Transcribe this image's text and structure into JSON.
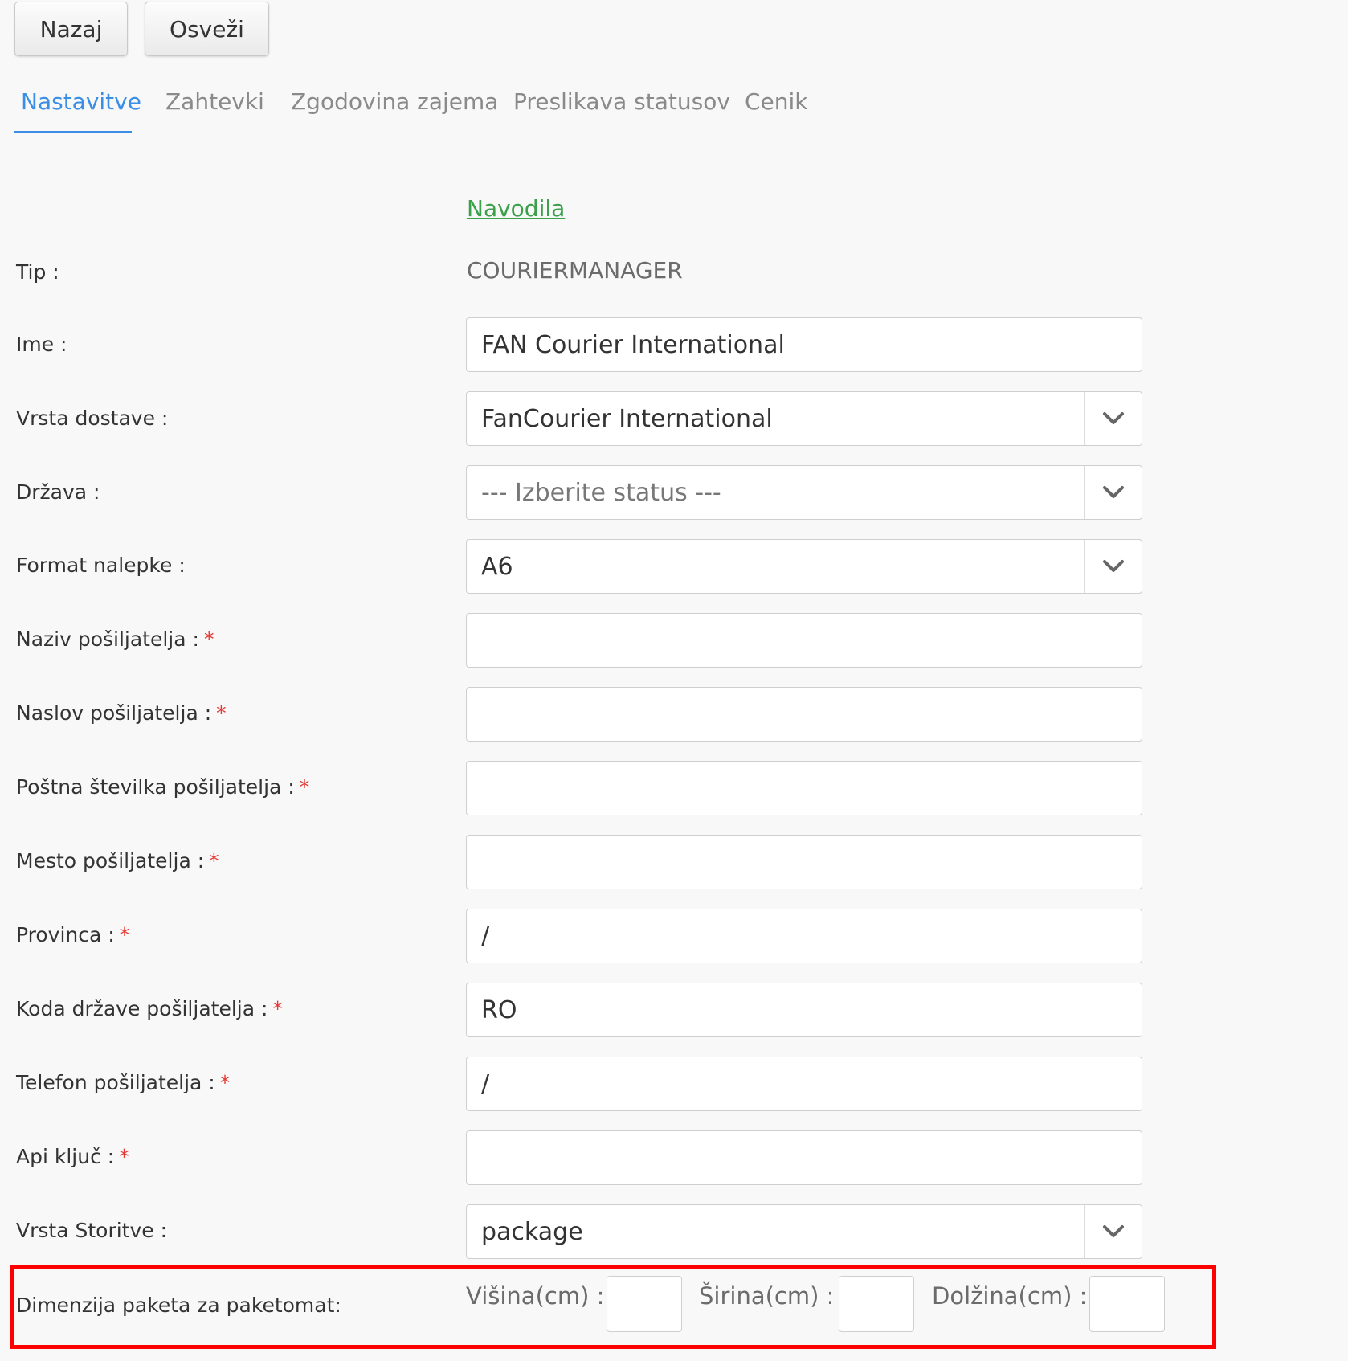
{
  "toolbar": {
    "back_label": "Nazaj",
    "refresh_label": "Osveži"
  },
  "tabs": [
    {
      "label": "Nastavitve",
      "active": true
    },
    {
      "label": "Zahtevki",
      "active": false
    },
    {
      "label": "Zgodovina zajema",
      "active": false
    },
    {
      "label": "Preslikava statusov",
      "active": false
    },
    {
      "label": "Cenik",
      "active": false
    }
  ],
  "instructions_link": "Navodila",
  "form": {
    "type": {
      "label": "Tip :",
      "value": "COURIERMANAGER"
    },
    "name": {
      "label": "Ime :",
      "value": "FAN Courier International"
    },
    "delivery_type": {
      "label": "Vrsta dostave :",
      "value": "FanCourier International"
    },
    "country": {
      "label": "Država :",
      "placeholder": "--- Izberite status ---"
    },
    "label_format": {
      "label": "Format nalepke :",
      "value": "A6"
    },
    "sender_name": {
      "label": "Naziv pošiljatelja :",
      "value": ""
    },
    "sender_address": {
      "label": "Naslov pošiljatelja :",
      "value": ""
    },
    "sender_postcode": {
      "label": "Poštna številka pošiljatelja :",
      "value": ""
    },
    "sender_city": {
      "label": "Mesto pošiljatelja :",
      "value": ""
    },
    "province": {
      "label": "Provinca :",
      "value": "/"
    },
    "sender_country_code": {
      "label": "Koda države pošiljatelja :",
      "value": "RO"
    },
    "sender_phone": {
      "label": "Telefon pošiljatelja :",
      "value": "/"
    },
    "api_key": {
      "label": "Api ključ :",
      "value": ""
    },
    "service_type": {
      "label": "Vrsta Storitve :",
      "value": "package"
    },
    "parcel_dimensions": {
      "label": "Dimenzija paketa za paketomat:",
      "height_label": "Višina(cm) :",
      "width_label": "Širina(cm) :",
      "length_label": "Dolžina(cm) :",
      "height": "",
      "width": "",
      "length": ""
    }
  },
  "required_marker": "*",
  "colors": {
    "accent": "#3a8ee6",
    "link": "#3aa04a",
    "required": "#e53935",
    "highlight": "#ff0000"
  }
}
